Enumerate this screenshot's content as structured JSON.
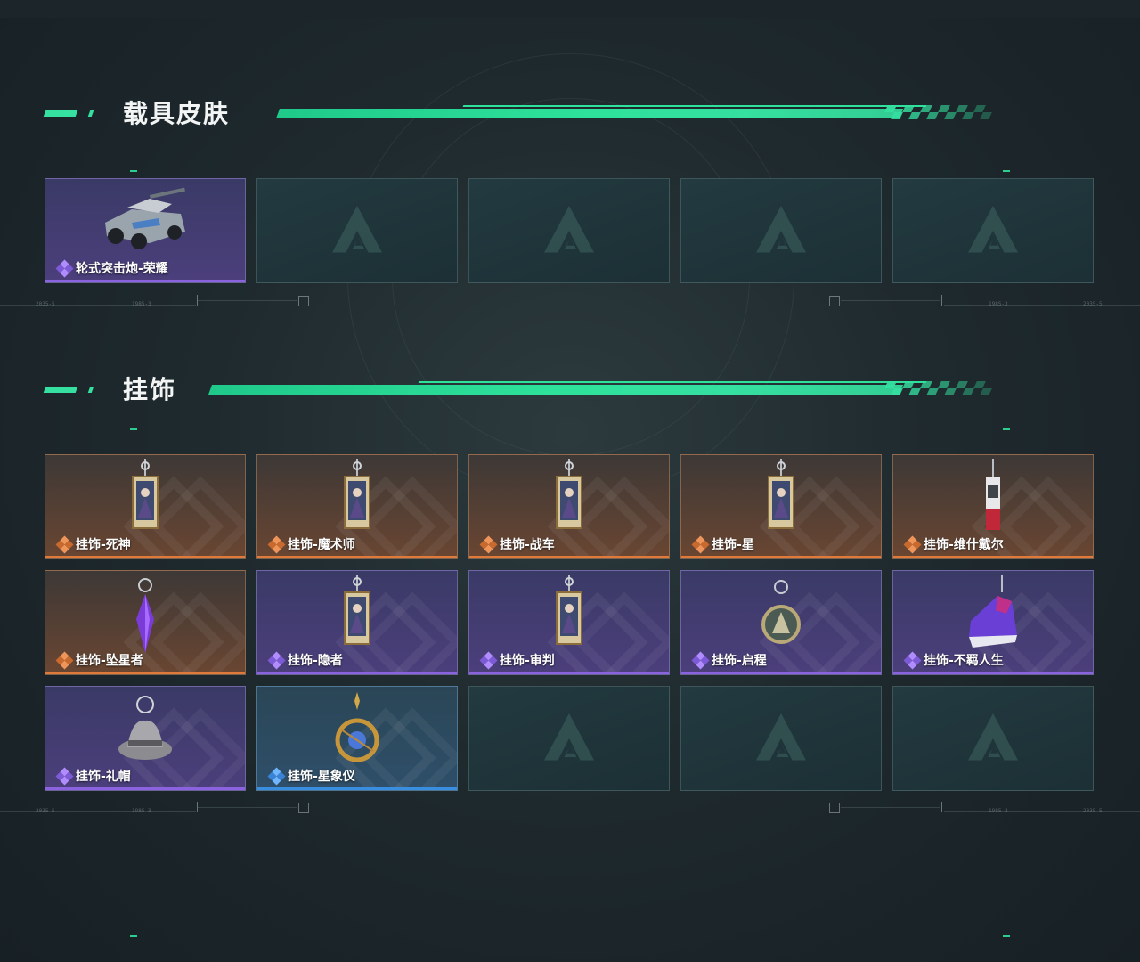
{
  "sections": [
    {
      "title": "载具皮肤",
      "cards": [
        {
          "label": "轮式突击炮-荣耀",
          "rarity": "purple",
          "art": "vehicle"
        },
        {
          "label": "",
          "rarity": "empty"
        },
        {
          "label": "",
          "rarity": "empty"
        },
        {
          "label": "",
          "rarity": "empty"
        },
        {
          "label": "",
          "rarity": "empty"
        }
      ]
    },
    {
      "title": "挂饰",
      "cards": [
        {
          "label": "挂饰-死神",
          "rarity": "orange",
          "art": "tarot-card"
        },
        {
          "label": "挂饰-魔术师",
          "rarity": "orange",
          "art": "tarot-card"
        },
        {
          "label": "挂饰-战车",
          "rarity": "orange",
          "art": "tarot-card"
        },
        {
          "label": "挂饰-星",
          "rarity": "orange",
          "art": "tarot-card"
        },
        {
          "label": "挂饰-维什戴尔",
          "rarity": "orange",
          "art": "tag"
        },
        {
          "label": "挂饰-坠星者",
          "rarity": "orange",
          "art": "crystal"
        },
        {
          "label": "挂饰-隐者",
          "rarity": "purple",
          "art": "tarot-card"
        },
        {
          "label": "挂饰-审判",
          "rarity": "purple",
          "art": "tarot-card"
        },
        {
          "label": "挂饰-启程",
          "rarity": "purple",
          "art": "medal"
        },
        {
          "label": "挂饰-不羁人生",
          "rarity": "purple",
          "art": "sneaker"
        },
        {
          "label": "挂饰-礼帽",
          "rarity": "purple",
          "art": "hat"
        },
        {
          "label": "挂饰-星象仪",
          "rarity": "blue",
          "art": "astrolabe"
        },
        {
          "label": "",
          "rarity": "empty"
        },
        {
          "label": "",
          "rarity": "empty"
        },
        {
          "label": "",
          "rarity": "empty"
        }
      ]
    }
  ],
  "colors": {
    "accent_green": "#35e0a0",
    "rarity_purple": "#8b63e0",
    "rarity_orange": "#e07a3a",
    "rarity_blue": "#3a8ee0"
  },
  "icons": {
    "rarity": "diamond-cluster-icon",
    "empty_slot": "delta-logo-icon"
  },
  "deco_labels": [
    "2035-5",
    "1985-3",
    "1985-3",
    "2035-5"
  ]
}
